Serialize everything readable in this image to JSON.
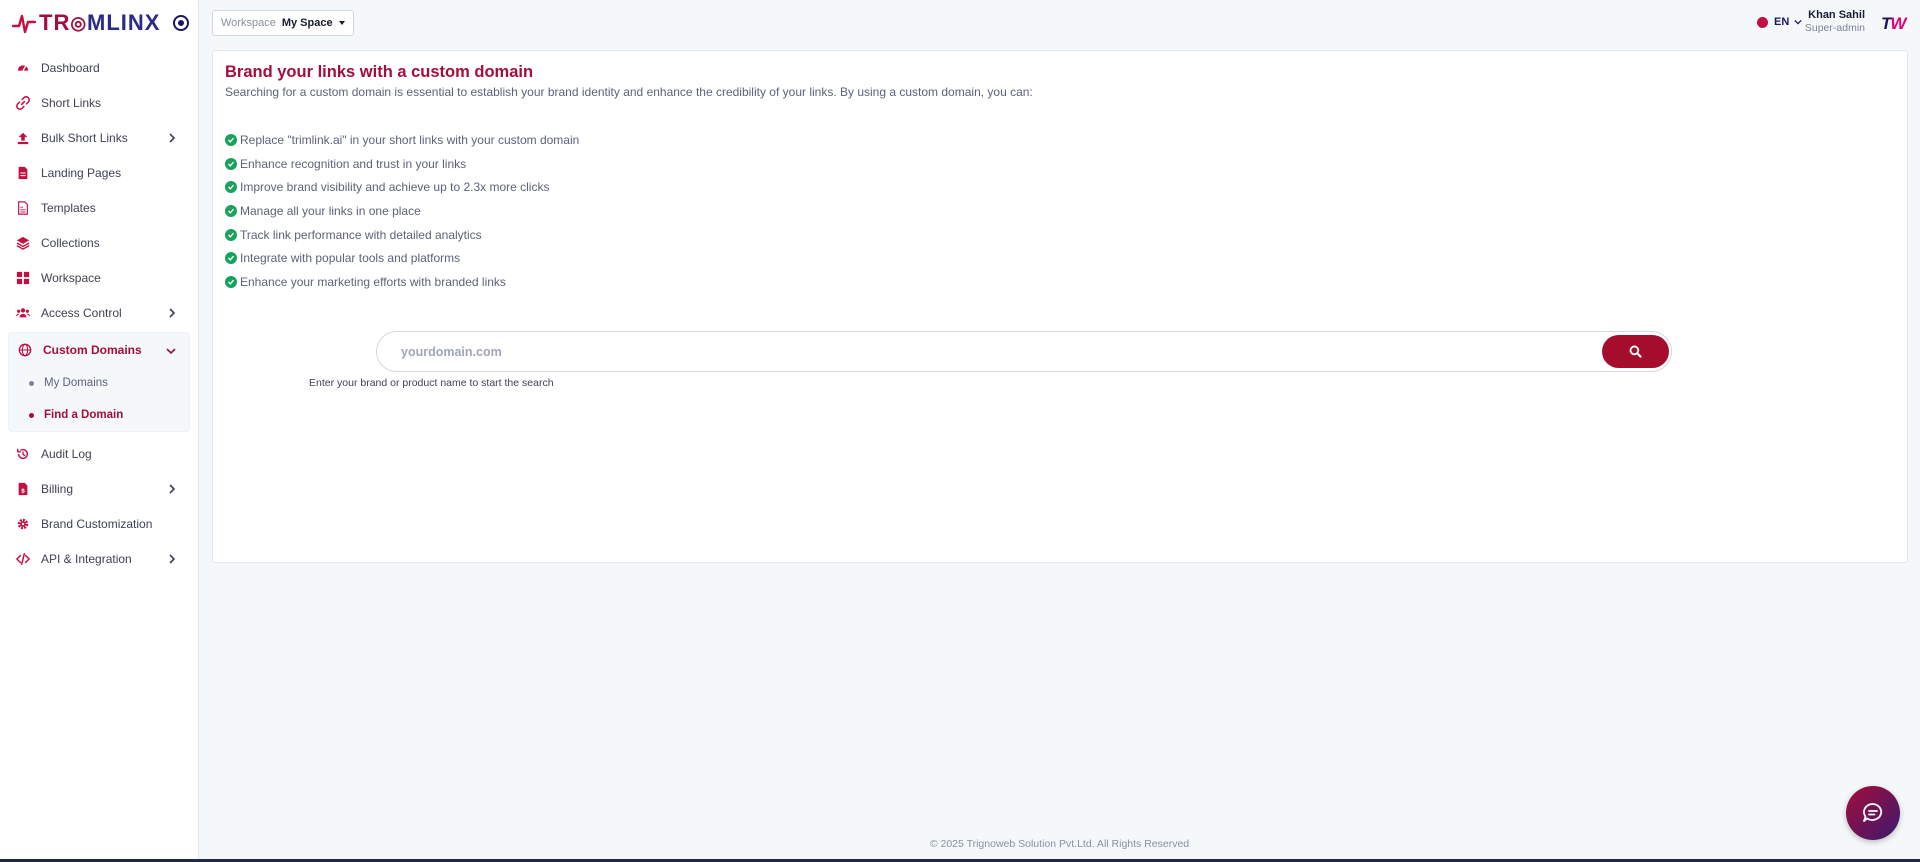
{
  "brand": {
    "logo_text_a": "TR",
    "logo_text_b": "MLINX",
    "accent": "#a50d3a",
    "navy": "#1b1464"
  },
  "sidebar": {
    "items": [
      {
        "label": "Dashboard",
        "icon": "dashboard-icon"
      },
      {
        "label": "Short Links",
        "icon": "link-icon"
      },
      {
        "label": "Bulk Short Links",
        "icon": "upload-icon"
      },
      {
        "label": "Landing Pages",
        "icon": "file-icon"
      },
      {
        "label": "Templates",
        "icon": "template-icon"
      },
      {
        "label": "Collections",
        "icon": "layers-icon"
      },
      {
        "label": "Workspace",
        "icon": "grid-icon"
      },
      {
        "label": "Access Control",
        "icon": "users-icon"
      }
    ],
    "group": {
      "label": "Custom Domains",
      "icon": "globe-icon",
      "children": [
        {
          "label": "My Domains"
        },
        {
          "label": "Find a Domain"
        }
      ]
    },
    "items_after": [
      {
        "label": "Audit Log",
        "icon": "history-icon"
      },
      {
        "label": "Billing",
        "icon": "invoice-icon"
      },
      {
        "label": "Brand Customization",
        "icon": "gear-icon"
      },
      {
        "label": "API & Integration",
        "icon": "code-icon"
      }
    ]
  },
  "header": {
    "workspace_label": "Workspace",
    "workspace_value": "My Space",
    "language": "EN",
    "user_name": "Khan Sahil",
    "user_role": "Super-admin",
    "avatar_a": "T",
    "avatar_b": "W"
  },
  "main": {
    "title": "Brand your links with a custom domain",
    "intro": "Searching for a custom domain is essential to establish your brand identity and enhance the credibility of your links. By using a custom domain, you can:",
    "features": [
      "Replace \"trimlink.ai\" in your short links with your custom domain",
      "Enhance recognition and trust in your links",
      "Improve brand visibility and achieve up to 2.3x more clicks",
      "Manage all your links in one place",
      "Track link performance with detailed analytics",
      "Integrate with popular tools and platforms",
      "Enhance your marketing efforts with branded links"
    ],
    "search_placeholder": "yourdomain.com",
    "search_hint": "Enter your brand or product name to start the search"
  },
  "footer": {
    "text": "© 2025 Trignoweb Solution Pvt.Ltd. All Rights Reserved"
  }
}
